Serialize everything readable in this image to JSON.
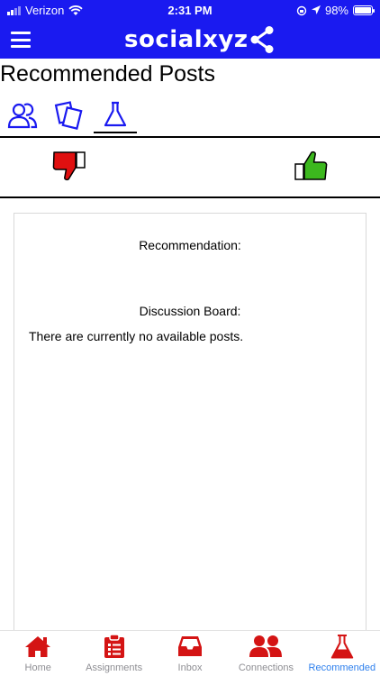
{
  "status_bar": {
    "carrier": "Verizon",
    "time": "2:31 PM",
    "battery": "98%",
    "battery_level": 0.98
  },
  "app_bar": {
    "logo_text": "socialxyz",
    "menu_icon": "hamburger-menu-icon"
  },
  "page": {
    "title": "Recommended Posts"
  },
  "tabs": [
    {
      "icon": "people-icon",
      "active": false
    },
    {
      "icon": "pages-icon",
      "active": false
    },
    {
      "icon": "flask-icon",
      "active": true
    }
  ],
  "vote": {
    "dislike_icon": "thumbs-down-icon",
    "like_icon": "thumbs-up-icon",
    "dislike_color": "#e01010",
    "like_color": "#3cb81e"
  },
  "card": {
    "recommendation_label": "Recommendation:",
    "discussion_label": "Discussion Board:",
    "empty_message": "There are currently no available posts."
  },
  "bottom_nav": [
    {
      "label": "Home",
      "icon": "home-icon",
      "active": false
    },
    {
      "label": "Assignments",
      "icon": "clipboard-icon",
      "active": false
    },
    {
      "label": "Inbox",
      "icon": "inbox-icon",
      "active": false
    },
    {
      "label": "Connections",
      "icon": "connections-icon",
      "active": false
    },
    {
      "label": "Recommended",
      "icon": "flask-icon",
      "active": true
    }
  ],
  "colors": {
    "brand_blue": "#1a1af0",
    "nav_red": "#d41414",
    "active_blue": "#2f80ed"
  }
}
